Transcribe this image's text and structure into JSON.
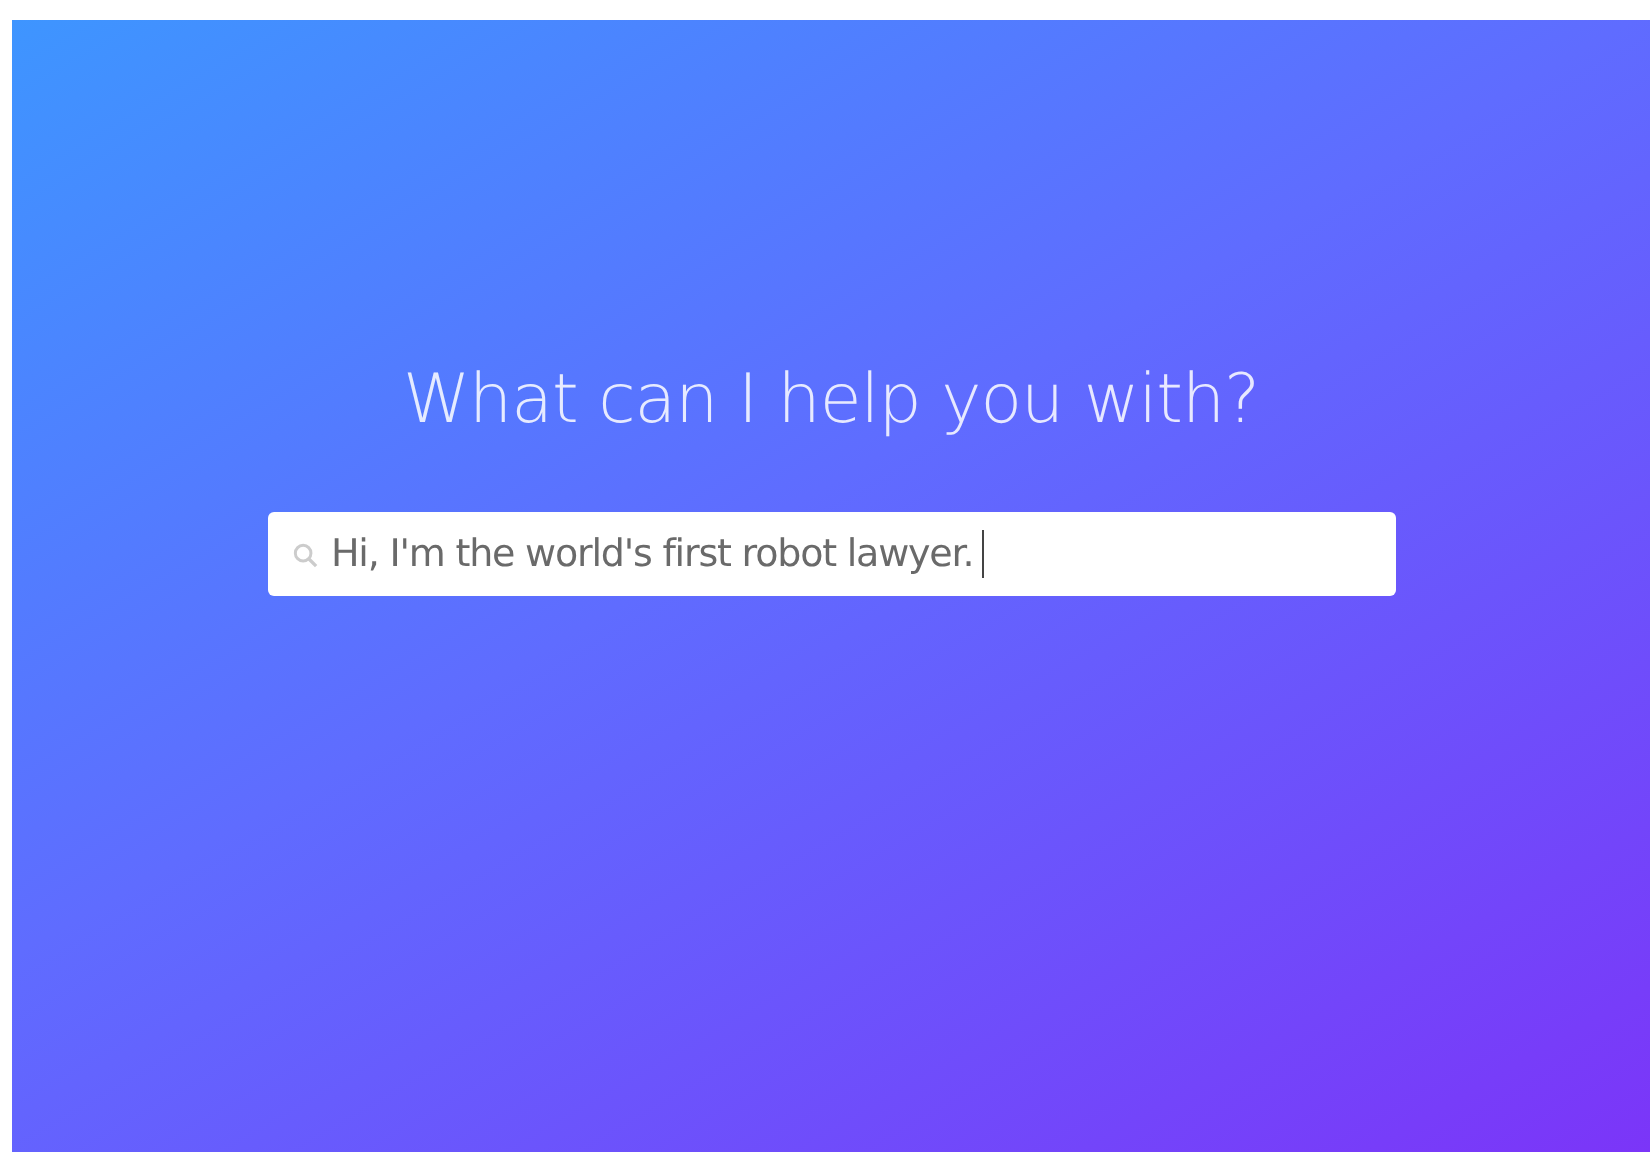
{
  "heading": "What can I help you with?",
  "search": {
    "value": "Hi, I'm the world's first robot lawyer.",
    "focused": true
  }
}
